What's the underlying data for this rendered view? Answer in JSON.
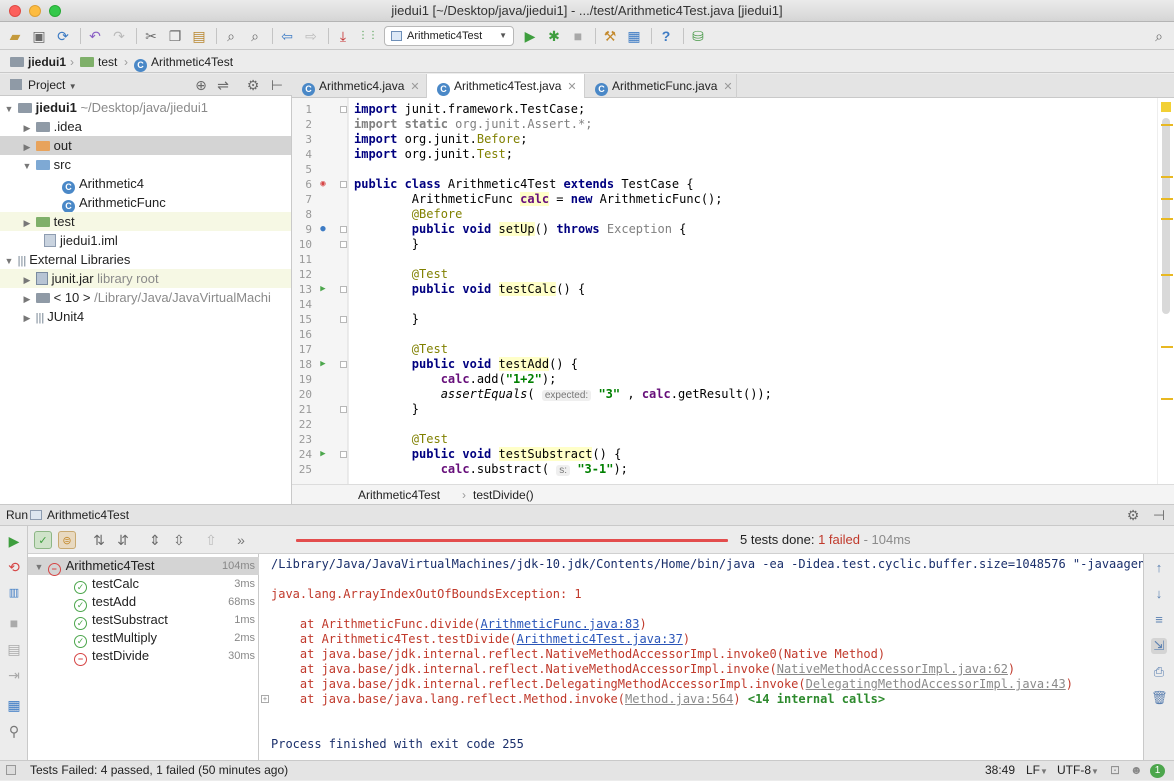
{
  "window": {
    "title": "jiedui1 [~/Desktop/java/jiedui1] - .../test/Arithmetic4Test.java [jiedui1]"
  },
  "toolbar": {
    "run_config": "Arithmetic4Test"
  },
  "navbar": {
    "crumbs": [
      "jiedui1",
      "test",
      "Arithmetic4Test"
    ]
  },
  "project": {
    "header_label": "Project",
    "tree": [
      {
        "label": "jiedui1",
        "extra": "~/Desktop/java/jiedui1"
      },
      {
        "label": ".idea"
      },
      {
        "label": "out"
      },
      {
        "label": "src"
      },
      {
        "label": "Arithmetic4"
      },
      {
        "label": "ArithmeticFunc"
      },
      {
        "label": "test"
      },
      {
        "label": "jiedui1.iml"
      },
      {
        "label": "External Libraries"
      },
      {
        "label": "junit.jar",
        "extra": "library root"
      },
      {
        "label": "< 10 >",
        "extra": "/Library/Java/JavaVirtualMachi"
      },
      {
        "label": "JUnit4"
      }
    ]
  },
  "editor": {
    "tabs": [
      {
        "label": "Arithmetic4.java"
      },
      {
        "label": "Arithmetic4Test.java"
      },
      {
        "label": "ArithmeticFunc.java"
      }
    ],
    "line_numbers": [
      "1",
      "2",
      "3",
      "4",
      "5",
      "6",
      "7",
      "8",
      "9",
      "10",
      "11",
      "12",
      "13",
      "14",
      "15",
      "16",
      "17",
      "18",
      "19",
      "20",
      "21",
      "22",
      "23",
      "24",
      "25"
    ],
    "code": {
      "l1_kw": "import",
      "l1_rest": " junit.framework.TestCase;",
      "l2_kw": "import static",
      "l2_rest": " org.junit.Assert.*;",
      "l3_kw": "import",
      "l3_rest": " org.junit.",
      "l3_anno": "Before",
      "l3_end": ";",
      "l4_kw": "import",
      "l4_rest": " org.junit.",
      "l4_anno": "Test",
      "l4_end": ";",
      "l6_kw1": "public class",
      "l6_name": " Arithmetic4Test ",
      "l6_kw2": "extends",
      "l6_rest": " TestCase {",
      "l7_type": "        ArithmeticFunc ",
      "l7_field": "calc",
      "l7_eq": " = ",
      "l7_kw": "new",
      "l7_rest": " ArithmeticFunc();",
      "l8_anno": "        @Before",
      "l9_kw": "        public void ",
      "l9_m": "setUp",
      "l9_mid": "() ",
      "l9_kw2": "throws",
      "l9_ex": " Exception",
      "l9_end": " {",
      "l10": "        }",
      "l12_anno": "        @Test",
      "l13_kw": "        public void ",
      "l13_m": "testCalc",
      "l13_end": "() {",
      "l15": "        }",
      "l17_anno": "        @Test",
      "l18_kw": "        public void ",
      "l18_m": "testAdd",
      "l18_end": "() {",
      "l19_field": "            calc",
      "l19_mid": ".add(",
      "l19_str": "\"1+2\"",
      "l19_end": ");",
      "l20_call": "            assertEquals",
      "l20_p": "( ",
      "l20_hint": "expected:",
      "l20_str": "\"3\"",
      "l20_mid": " , ",
      "l20_field": "calc",
      "l20_end": ".getResult());",
      "l21": "        }",
      "l23_anno": "        @Test",
      "l24_kw": "        public void ",
      "l24_m": "testSubstract",
      "l24_end": "() {",
      "l25_field": "            calc",
      "l25_mid": ".substract( ",
      "l25_hint": "s:",
      "l25_str": "\"3-1\"",
      "l25_end": ");"
    },
    "breadcrumb": [
      "Arithmetic4Test",
      "testDivide()"
    ]
  },
  "run": {
    "header_label": "Run",
    "config_name": "Arithmetic4Test",
    "summary_prefix": "5 tests done: ",
    "summary_failed": "1 failed",
    "summary_suffix": " - 104ms",
    "progress": 1.0,
    "tests": [
      {
        "name": "Arithmetic4Test",
        "time": "104ms",
        "status": "fail"
      },
      {
        "name": "testCalc",
        "time": "3ms",
        "status": "ok"
      },
      {
        "name": "testAdd",
        "time": "68ms",
        "status": "ok"
      },
      {
        "name": "testSubstract",
        "time": "1ms",
        "status": "ok"
      },
      {
        "name": "testMultiply",
        "time": "2ms",
        "status": "ok"
      },
      {
        "name": "testDivide",
        "time": "30ms",
        "status": "fail"
      }
    ],
    "console": {
      "cmd": "/Library/Java/JavaVirtualMachines/jdk-10.jdk/Contents/Home/bin/java -ea -Didea.test.cyclic.buffer.size=1048576 \"-javaagent:/",
      "exception": "java.lang.ArrayIndexOutOfBoundsException: 1",
      "t1_pre": "    at ArithmeticFunc.divide(",
      "t1_link": "ArithmeticFunc.java:83",
      "t1_end": ")",
      "t2_pre": "    at Arithmetic4Test.testDivide(",
      "t2_link": "Arithmetic4Test.java:37",
      "t2_end": ")",
      "t3": "    at java.base/jdk.internal.reflect.NativeMethodAccessorImpl.invoke0(Native Method)",
      "t4_pre": "    at java.base/jdk.internal.reflect.NativeMethodAccessorImpl.invoke(",
      "t4_link": "NativeMethodAccessorImpl.java:62",
      "t4_end": ")",
      "t5_pre": "    at java.base/jdk.internal.reflect.DelegatingMethodAccessorImpl.invoke(",
      "t5_link": "DelegatingMethodAccessorImpl.java:43",
      "t5_end": ")",
      "t6_pre": "    at java.base/java.lang.reflect.Method.invoke(",
      "t6_link": "Method.java:564",
      "t6_end": ") ",
      "t6_internal": "<14 internal calls>",
      "finish": "Process finished with exit code 255"
    }
  },
  "status": {
    "message": "Tests Failed: 4 passed, 1 failed (50 minutes ago)",
    "position": "38:49",
    "line_sep": "LF",
    "encoding": "UTF-8",
    "notifications": "1"
  },
  "colors": {
    "accent_fail": "#e34d4d",
    "pass": "#4ca64c",
    "keyword": "#000080",
    "annotation": "#808000",
    "string": "#008000"
  }
}
